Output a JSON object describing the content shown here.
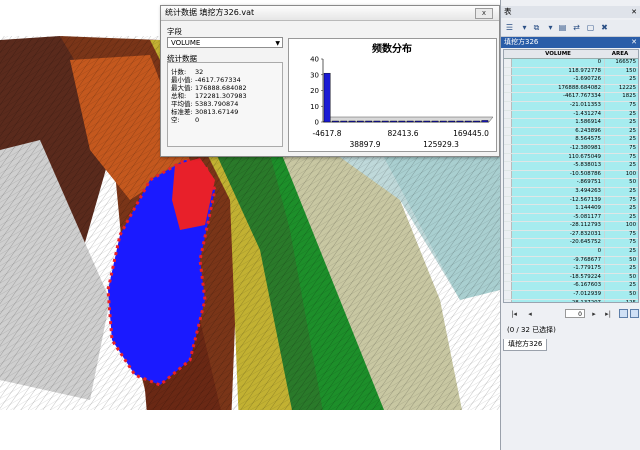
{
  "stats_window": {
    "title": "统计数据 填挖方326.vat",
    "close": "x",
    "field_label": "字段",
    "field_value": "VOLUME",
    "stats_label": "统计数据",
    "stats": [
      {
        "k": "计数:",
        "v": "32"
      },
      {
        "k": "最小值:",
        "v": "-4617.767334"
      },
      {
        "k": "最大值:",
        "v": "176888.684082"
      },
      {
        "k": "总和:",
        "v": "172281.307983"
      },
      {
        "k": "平均值:",
        "v": "5383.790874"
      },
      {
        "k": "标准差:",
        "v": "30813.67149"
      },
      {
        "k": "空:",
        "v": "0"
      }
    ]
  },
  "chart_data": {
    "type": "bar",
    "title": "频数分布",
    "ylim": [
      0,
      40
    ],
    "yticks": [
      "40",
      "30",
      "20",
      "10",
      "0"
    ],
    "xticks_top": [
      "-4617.8",
      "82413.6",
      "169445.0"
    ],
    "xticks_bottom": [
      "38897.9",
      "125929.3"
    ],
    "values": [
      31,
      0,
      0,
      0,
      0,
      0,
      0,
      0,
      0,
      0,
      0,
      0,
      0,
      0,
      0,
      0,
      0,
      0,
      0,
      1
    ],
    "bar_color": "#1a1ad4"
  },
  "table_panel": {
    "title": "表",
    "table_name": "填挖方326",
    "columns": [
      "VOLUME",
      "AREA"
    ],
    "rows": [
      [
        "0",
        "166575"
      ],
      [
        "118.972778",
        "150"
      ],
      [
        "-1.690726",
        "25"
      ],
      [
        "176888.684082",
        "12225"
      ],
      [
        "-4617.767334",
        "1825"
      ],
      [
        "-21.011353",
        "75"
      ],
      [
        "-1.431274",
        "25"
      ],
      [
        "1.586914",
        "25"
      ],
      [
        "6.243896",
        "25"
      ],
      [
        "8.564575",
        "25"
      ],
      [
        "-12.380981",
        "75"
      ],
      [
        "110.675049",
        "75"
      ],
      [
        "-5.838013",
        "25"
      ],
      [
        "-10.508786",
        "100"
      ],
      [
        "-.869751",
        "50"
      ],
      [
        "3.494263",
        "25"
      ],
      [
        "-12.567139",
        "75"
      ],
      [
        "1.144409",
        "25"
      ],
      [
        "-5.081177",
        "25"
      ],
      [
        "-28.112793",
        "100"
      ],
      [
        "-27.832031",
        "75"
      ],
      [
        "-20.645752",
        "75"
      ],
      [
        "0",
        "25"
      ],
      [
        "-9.768677",
        "50"
      ],
      [
        "-1.779175",
        "25"
      ],
      [
        "-18.579224",
        "50"
      ],
      [
        "-6.167603",
        "25"
      ],
      [
        "-7.012939",
        "50"
      ],
      [
        "-28.137207",
        "125"
      ],
      [
        "9.066772",
        "25"
      ]
    ],
    "nav_value": "0",
    "selection_text": "(0 / 32 已选择)",
    "bottom_tab": "填挖方326"
  }
}
